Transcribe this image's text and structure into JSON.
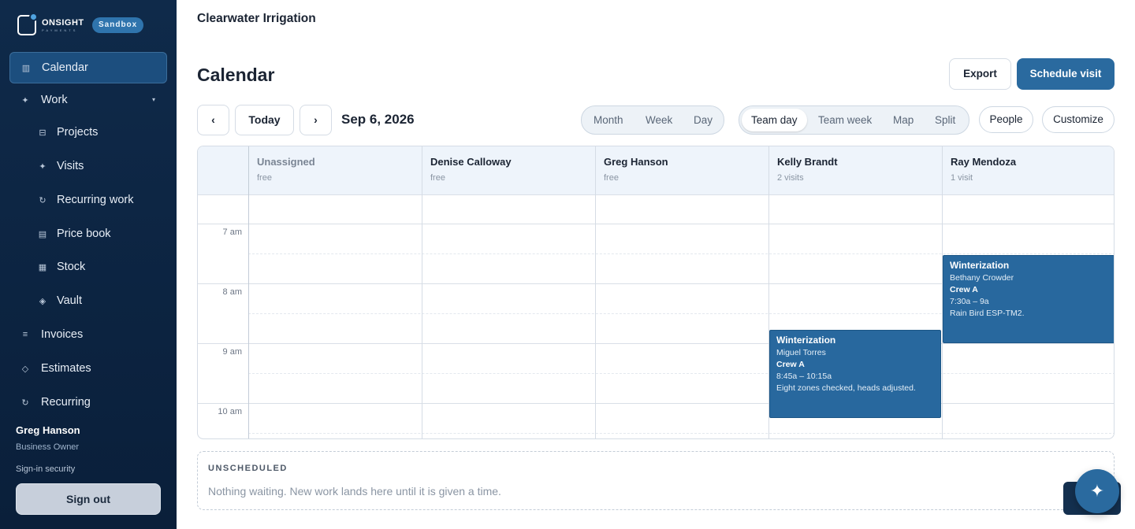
{
  "brand": {
    "name": "ONSIGHT",
    "tagline": "PAYMENTS",
    "env_badge": "Sandbox"
  },
  "sidebar": {
    "active": {
      "label": "Calendar",
      "icon": "calendar-grid-icon"
    },
    "work": {
      "label": "Work",
      "icon": "sparkle-icon",
      "expanded": true
    },
    "work_items": [
      {
        "label": "Projects",
        "icon": "folder-icon"
      },
      {
        "label": "Visits",
        "icon": "sparkle-icon"
      },
      {
        "label": "Recurring work",
        "icon": "refresh-icon"
      },
      {
        "label": "Price book",
        "icon": "book-icon"
      },
      {
        "label": "Stock",
        "icon": "box-icon"
      },
      {
        "label": "Vault",
        "icon": "diamond-icon"
      }
    ],
    "items": [
      {
        "label": "Invoices",
        "icon": "list-icon"
      },
      {
        "label": "Estimates",
        "icon": "diamond-outline-icon"
      },
      {
        "label": "Recurring",
        "icon": "refresh-icon"
      }
    ],
    "user": {
      "name": "Greg Hanson",
      "role": "Business Owner"
    },
    "signin_security": "Sign-in security",
    "sign_out": "Sign out"
  },
  "header": {
    "company": "Clearwater Irrigation"
  },
  "main": {
    "title": "Calendar",
    "export_label": "Export",
    "schedule_label": "Schedule visit",
    "today_label": "Today",
    "prev_label": "‹",
    "next_label": "›",
    "date": "Sep 6, 2026",
    "view_modes": [
      "Month",
      "Week",
      "Day"
    ],
    "team_modes": [
      "Team day",
      "Team week",
      "Map",
      "Split"
    ],
    "team_selected": "Team day",
    "people_label": "People",
    "customize_label": "Customize"
  },
  "calendar": {
    "columns": [
      {
        "name": "Unassigned",
        "sub": "free"
      },
      {
        "name": "Denise Calloway",
        "sub": "free"
      },
      {
        "name": "Greg Hanson",
        "sub": "free"
      },
      {
        "name": "Kelly Brandt",
        "sub": "2 visits"
      },
      {
        "name": "Ray Mendoza",
        "sub": "1 visit"
      }
    ],
    "times": [
      "7 am",
      "8 am",
      "9 am",
      "10 am"
    ],
    "events": [
      {
        "title": "Winterization",
        "customer": "Miguel Torres",
        "crew": "Crew A",
        "time": "8:45a – 10:15a",
        "note": "Eight zones checked, heads adjusted."
      },
      {
        "title": "Winterization",
        "customer": "Bethany Crowder",
        "crew": "Crew A",
        "time": "7:30a – 9a",
        "note": "Rain Bird ESP-TM2."
      }
    ]
  },
  "unscheduled": {
    "heading": "UNSCHEDULED",
    "message": "Nothing waiting. New work lands here until it is given a time."
  },
  "assistant": {
    "icon": "sparkle-icon"
  },
  "colors": {
    "sidebar": "#0f2a4a",
    "accent": "#2a6a9f",
    "event": "#28689e"
  }
}
